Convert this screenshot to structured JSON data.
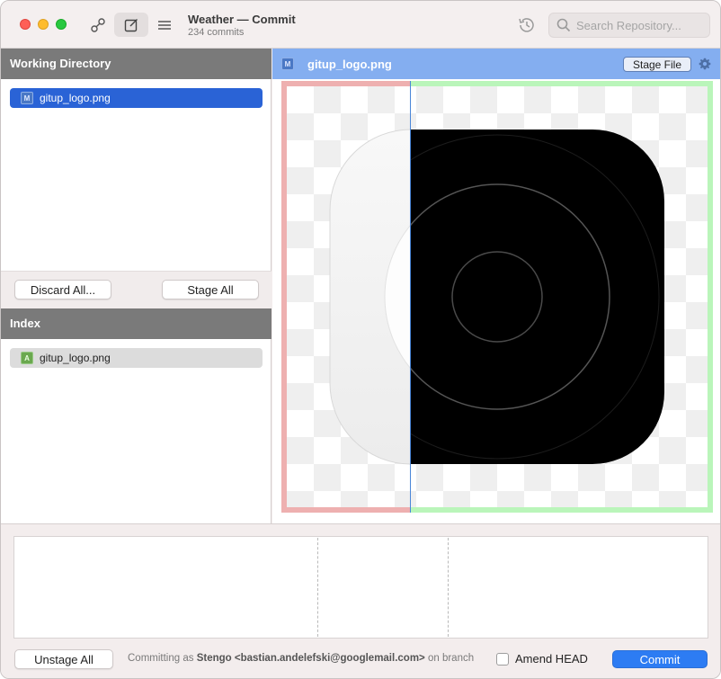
{
  "window": {
    "title": "Weather — Commit",
    "subtitle": "234 commits"
  },
  "toolbar": {
    "search_placeholder": "Search Repository..."
  },
  "working_directory": {
    "header": "Working Directory",
    "files": [
      {
        "status": "M",
        "name": "gitup_logo.png",
        "selected": true
      }
    ],
    "discard_label": "Discard All...",
    "stage_all_label": "Stage All"
  },
  "index": {
    "header": "Index",
    "files": [
      {
        "status": "A",
        "name": "gitup_logo.png"
      }
    ]
  },
  "diff": {
    "status": "M",
    "file_name": "gitup_logo.png",
    "stage_file_label": "Stage File",
    "old_border_color": "#eeb0b0",
    "new_border_color": "#baf5ba"
  },
  "commit": {
    "message": "",
    "unstage_all_label": "Unstage All",
    "committing_prefix": "Committing as",
    "author": "Stengo <bastian.andelefski@googlemail.com>",
    "committing_suffix": "on branch",
    "amend_label": "Amend HEAD",
    "amend_checked": false,
    "commit_label": "Commit"
  },
  "colors": {
    "accent": "#2d7cf3",
    "selection": "#2a63d6",
    "section_header": "#7a7a7a",
    "file_header": "#84aef0"
  }
}
